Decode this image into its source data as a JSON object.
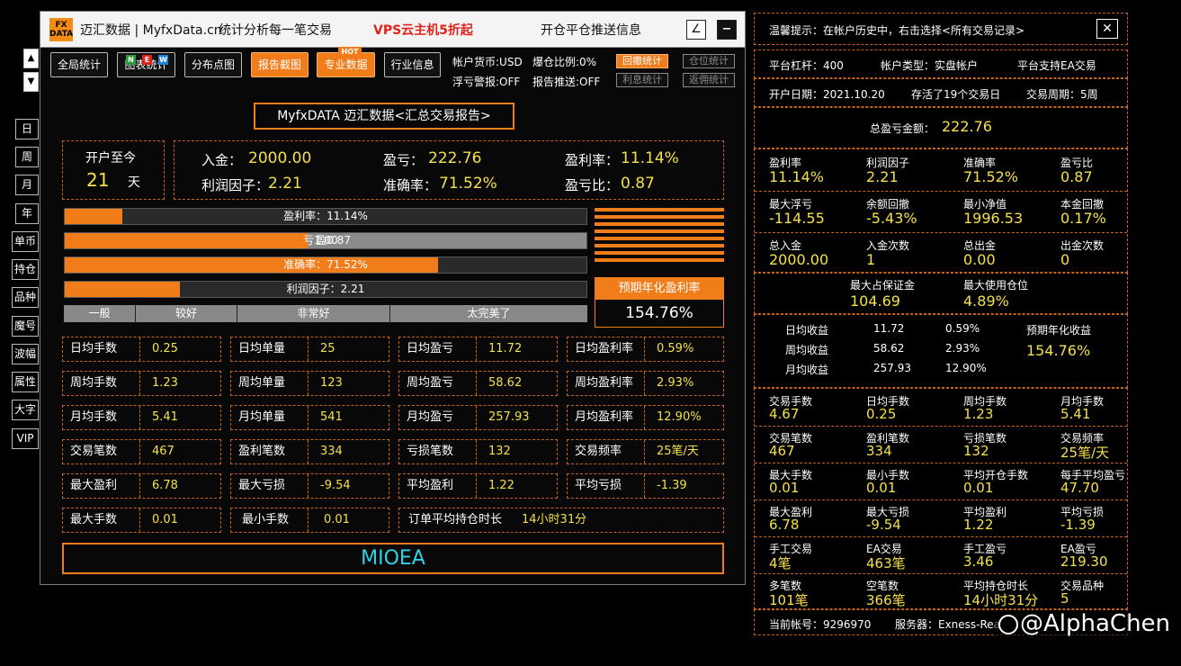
{
  "window": {
    "logo": "FX DATA",
    "title": "迈汇数据 | MyfxData.cn",
    "subtitle": "统计分析每一笔交易",
    "promo": "VPS云主机5折起",
    "push": "开仓平仓推送信息",
    "btn_edit": "∠",
    "btn_min": "−"
  },
  "nav": {
    "tabs": [
      "全局统计",
      "图表统计",
      "分布点图",
      "报告截图",
      "专业数据",
      "行业信息"
    ],
    "badge_new": [
      "N",
      "E",
      "W"
    ],
    "badge_hot": "HOT",
    "info": {
      "currency": "帐户货币:USD",
      "exposure": "爆仓比例:0%",
      "float_alert": "浮亏警报:OFF",
      "report_push": "报告推送:OFF"
    },
    "small_btns": [
      "回撤统计",
      "仓位统计",
      "利息统计",
      "返佣统计"
    ]
  },
  "side": {
    "up": "▲",
    "down": "▼",
    "items": [
      "日",
      "周",
      "月",
      "年",
      "单币",
      "持仓",
      "品种",
      "魔号",
      "波幅",
      "属性",
      "大字",
      "VIP"
    ]
  },
  "report": {
    "title": "MyfxDATA 迈汇数据<汇总交易报告>",
    "open_label": "开户至今",
    "days": "21",
    "days_unit": "天",
    "deposit_label": "入金：",
    "deposit": "2000.00",
    "pnl_label": "盈亏：",
    "pnl": "222.76",
    "win_rate_label": "盈利率：",
    "win_rate": "11.14%",
    "pf_label": "利润因子：",
    "pf": "2.21",
    "acc_label": "准确率：",
    "acc": "71.52%",
    "ratio_label": "盈亏比：",
    "ratio": "0.87"
  },
  "bars": {
    "profit_rate": {
      "label": "盈利率：11.14%",
      "fill": 0.111
    },
    "winloss": {
      "win": "盈0.87",
      "loss": "亏1.00",
      "fill": 0.465
    },
    "accuracy": {
      "label": "准确率：71.52%",
      "fill": 0.715
    },
    "profit_factor": {
      "label": "利润因子：2.21",
      "fill": 0.221
    },
    "scale": [
      "一般",
      "较好",
      "非常好",
      "太完美了"
    ]
  },
  "annual": {
    "label": "预期年化盈利率",
    "value": "154.76%"
  },
  "grid": [
    [
      [
        "日均手数",
        "0.25"
      ],
      [
        "日均单量",
        "25"
      ],
      [
        "日均盈亏",
        "11.72"
      ],
      [
        "日均盈利率",
        "0.59%"
      ]
    ],
    [
      [
        "周均手数",
        "1.23"
      ],
      [
        "周均单量",
        "123"
      ],
      [
        "周均盈亏",
        "58.62"
      ],
      [
        "周均盈利率",
        "2.93%"
      ]
    ],
    [
      [
        "月均手数",
        "5.41"
      ],
      [
        "月均单量",
        "541"
      ],
      [
        "月均盈亏",
        "257.93"
      ],
      [
        "月均盈利率",
        "12.90%"
      ]
    ],
    [
      [
        "交易笔数",
        "467"
      ],
      [
        "盈利笔数",
        "334"
      ],
      [
        "亏损笔数",
        "132"
      ],
      [
        "交易频率",
        "25笔/天"
      ]
    ],
    [
      [
        "最大盈利",
        "6.78"
      ],
      [
        "最大亏损",
        "-9.54"
      ],
      [
        "平均盈利",
        "1.22"
      ],
      [
        "平均亏损",
        "-1.39"
      ]
    ]
  ],
  "last_row": {
    "max_lots_label": "最大手数",
    "max_lots": "0.01",
    "min_lots_label": "最小手数",
    "min_lots": "0.01",
    "hold_label": "订单平均持仓时长",
    "hold": "14小时31分"
  },
  "footer_brand": "MIOEA",
  "right": {
    "tip": "温馨提示：在帐户历史中，右击选择<所有交易记录>",
    "close": "✕",
    "leverage": "平台杠杆：400",
    "acct_type": "帐户类型：实盘帐户",
    "ea_support": "平台支持EA交易",
    "open_date": "开户日期：2021.10.20",
    "stored": "存活了19个交易日",
    "cycle": "交易周期：5周",
    "total_pnl_label": "总盈亏金额：",
    "total_pnl": "222.76",
    "block1": [
      [
        "盈利率",
        "11.14%"
      ],
      [
        "利润因子",
        "2.21"
      ],
      [
        "准确率",
        "71.52%"
      ],
      [
        "盈亏比",
        "0.87"
      ],
      [
        "最大浮亏",
        "-114.55"
      ],
      [
        "余额回撤",
        "-5.43%"
      ],
      [
        "最小净值",
        "1996.53"
      ],
      [
        "本金回撤",
        "0.17%"
      ],
      [
        "总入金",
        "2000.00"
      ],
      [
        "入金次数",
        "1"
      ],
      [
        "总出金",
        "0.00"
      ],
      [
        "出金次数",
        "0"
      ]
    ],
    "margin_label": "最大占保证金",
    "margin": "104.69",
    "pos_label": "最大使用仓位",
    "pos": "4.89%",
    "income": [
      [
        "日均收益",
        "11.72",
        "0.59%"
      ],
      [
        "周均收益",
        "58.62",
        "2.93%"
      ],
      [
        "月均收益",
        "257.93",
        "12.90%"
      ]
    ],
    "annual_label": "预期年化收益",
    "annual": "154.76%",
    "block2": [
      [
        "交易手数",
        "4.67"
      ],
      [
        "日均手数",
        "0.25"
      ],
      [
        "周均手数",
        "1.23"
      ],
      [
        "月均手数",
        "5.41"
      ],
      [
        "交易笔数",
        "467"
      ],
      [
        "盈利笔数",
        "334"
      ],
      [
        "亏损笔数",
        "132"
      ],
      [
        "交易频率",
        "25笔/天"
      ],
      [
        "最大手数",
        "0.01"
      ],
      [
        "最小手数",
        "0.01"
      ],
      [
        "平均开仓手数",
        "0.01"
      ],
      [
        "每手平均盈亏",
        "47.70"
      ],
      [
        "最大盈利",
        "6.78"
      ],
      [
        "最大亏损",
        "-9.54"
      ],
      [
        "平均盈利",
        "1.22"
      ],
      [
        "平均亏损",
        "-1.39"
      ],
      [
        "手工交易",
        "4笔"
      ],
      [
        "EA交易",
        "463笔"
      ],
      [
        "手工盈亏",
        "3.46"
      ],
      [
        "EA盈亏",
        "219.30"
      ],
      [
        "多笔数",
        "101笔"
      ],
      [
        "空笔数",
        "366笔"
      ],
      [
        "平均持仓时长",
        "14小时31分"
      ],
      [
        "交易品种",
        "5"
      ]
    ],
    "account": "当前帐号：9296970",
    "server": "服务器：Exness-Rea"
  },
  "watermark": "@AlphaChen",
  "colors": {
    "accent": "#f07d1a",
    "value": "#f5e04a",
    "border": "#c8641a",
    "bg": "#000000"
  }
}
